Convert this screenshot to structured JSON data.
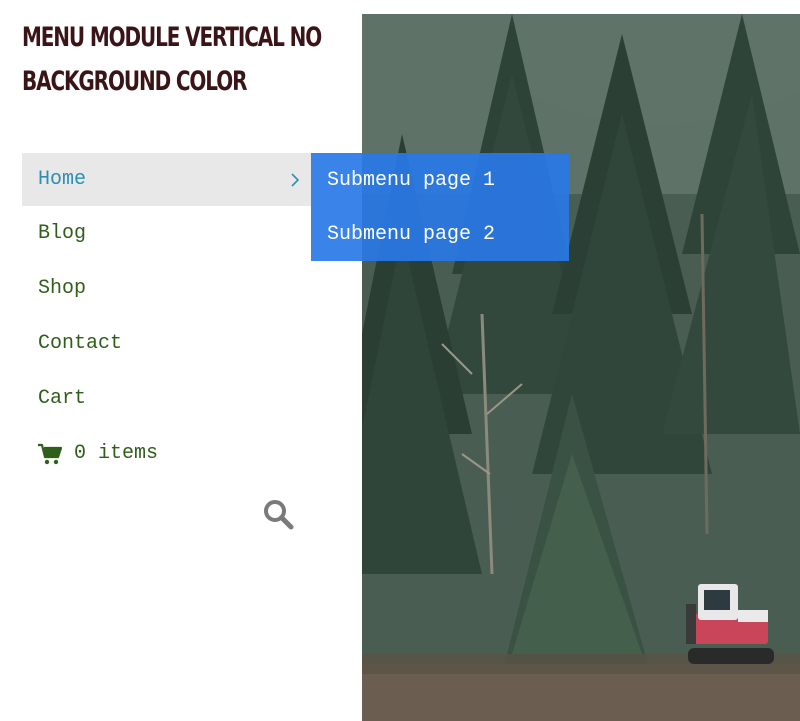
{
  "module": {
    "title": "Menu Module Vertical No Background Color"
  },
  "menu": {
    "items": [
      {
        "label": "Home",
        "has_submenu": true,
        "active": true
      },
      {
        "label": "Blog"
      },
      {
        "label": "Shop"
      },
      {
        "label": "Contact"
      },
      {
        "label": "Cart"
      }
    ],
    "cart_count": "0 items"
  },
  "submenu": {
    "items": [
      {
        "label": "Submenu page 1"
      },
      {
        "label": "Submenu page 2"
      }
    ]
  },
  "icons": {
    "chevron": "chevron-right-icon",
    "cart": "shopping-cart-icon",
    "search": "search-icon"
  },
  "colors": {
    "title": "#3a1417",
    "menu_text": "#2f5f1a",
    "menu_active_text": "#2f8fb3",
    "menu_active_bg": "#e8e8e8",
    "submenu_bg": "#2978e6",
    "search_icon": "#7a7a7a"
  }
}
